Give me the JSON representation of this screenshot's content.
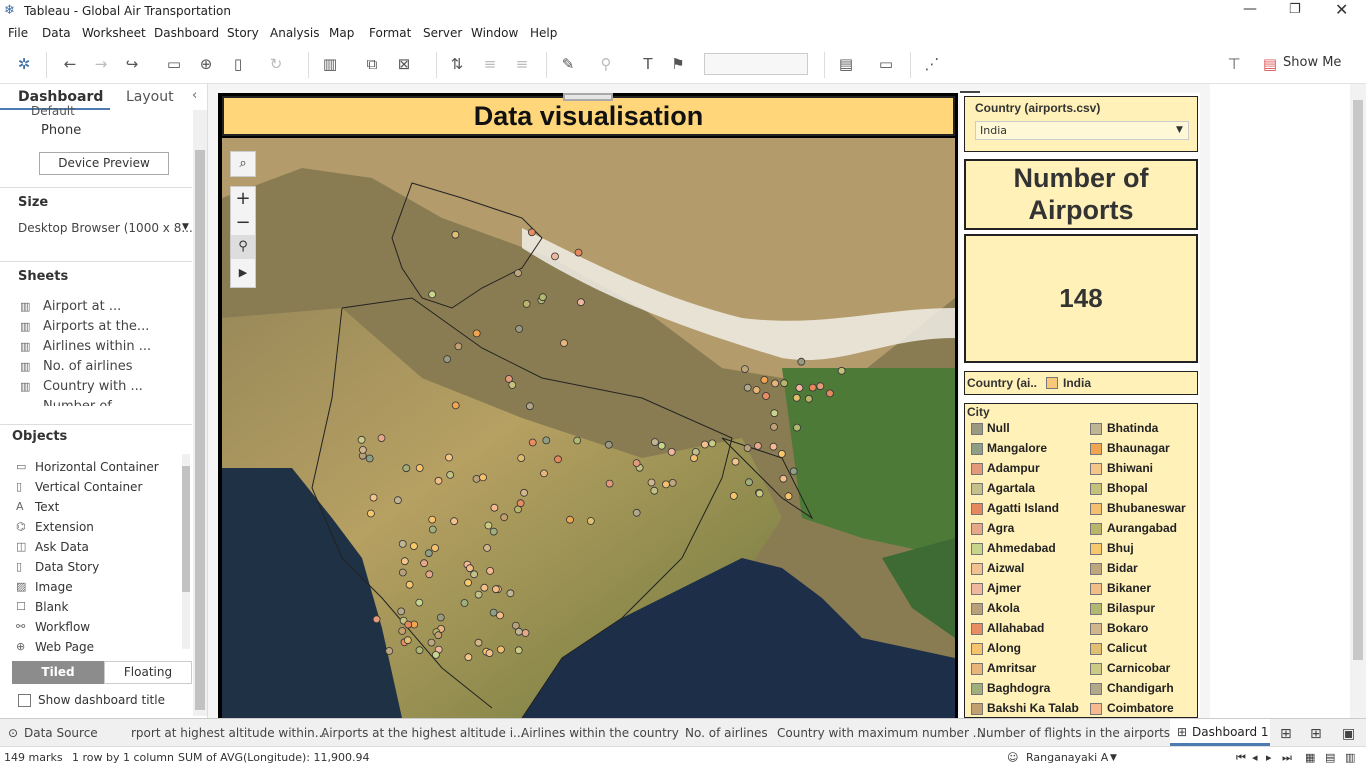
{
  "app": {
    "title": "Tableau - Global Air Transportation"
  },
  "menu": [
    "File",
    "Data",
    "Worksheet",
    "Dashboard",
    "Story",
    "Analysis",
    "Map",
    "Format",
    "Server",
    "Window",
    "Help"
  ],
  "toolbar": {
    "show_me": "Show Me"
  },
  "left_panel": {
    "tab_dashboard": "Dashboard",
    "tab_layout": "Layout",
    "default_label": "Default",
    "phone_label": "Phone",
    "device_preview": "Device Preview",
    "size_heading": "Size",
    "size_value": "Desktop Browser (1000 x 8...",
    "sheets_heading": "Sheets",
    "sheets": [
      "Airport at ...",
      "Airports at the...",
      "Airlines within ...",
      "No. of airlines",
      "Country with ...",
      "Number of ..."
    ],
    "objects_heading": "Objects",
    "objects": [
      "Horizontal Container",
      "Vertical Container",
      "Text",
      "Extension",
      "Ask Data",
      "Data Story",
      "Image",
      "Blank",
      "Workflow",
      "Web Page"
    ],
    "tiled": "Tiled",
    "floating": "Floating",
    "show_title": "Show dashboard title"
  },
  "dashboard": {
    "title": "Data visualisation",
    "filter_label": "Country (airports.csv)",
    "filter_value": "India",
    "count_title_1": "Number of",
    "count_title_2": "Airports",
    "count_value": "148",
    "country_legend_label": "Country (ai..",
    "country_legend_value": "India",
    "city_heading": "City",
    "cities_col1": [
      "Null",
      "Mangalore",
      "Adampur",
      "Agartala",
      "Agatti Island",
      "Agra",
      "Ahmedabad",
      "Aizwal",
      "Ajmer",
      "Akola",
      "Allahabad",
      "Along",
      "Amritsar",
      "Baghdogra",
      "Bakshi Ka Talab"
    ],
    "cities_col2": [
      "Bhatinda",
      "Bhaunagar",
      "Bhiwani",
      "Bhopal",
      "Bhubaneswar",
      "Aurangabad",
      "Bhuj",
      "Bidar",
      "Bikaner",
      "Bilaspur",
      "Bokaro",
      "Calicut",
      "Carnicobar",
      "Chandigarh",
      "Coimbatore"
    ],
    "colors_col1": [
      "#9a9a82",
      "#8e9f86",
      "#e39a7a",
      "#c3c08a",
      "#e6885e",
      "#e7a88a",
      "#c8d48a",
      "#f3c08f",
      "#efb79d",
      "#b8a078",
      "#e88c63",
      "#f6c36c",
      "#e8b479",
      "#9fae7a",
      "#c2a070"
    ],
    "colors_col2": [
      "#c0b696",
      "#f2a550",
      "#f6c589",
      "#c4c27a",
      "#f4c070",
      "#b9b56a",
      "#f8c86a",
      "#bea67e",
      "#f3bd88",
      "#b1b86f",
      "#d2b58b",
      "#e0c070",
      "#cbcb86",
      "#b0a888",
      "#f6b990"
    ]
  },
  "tabs": [
    "Data Source",
    "rport at highest altitude within...",
    "Airports at the highest altitude i...",
    "Airlines within the country",
    "No. of airlines",
    "Country with maximum number ...",
    "Number of flights in the airports",
    "Dashboard 1"
  ],
  "status": {
    "marks": "149 marks",
    "rows": "1 row by 1 column",
    "sum": "SUM of AVG(Longitude): 11,900.94",
    "user": "Ranganayaki A"
  }
}
